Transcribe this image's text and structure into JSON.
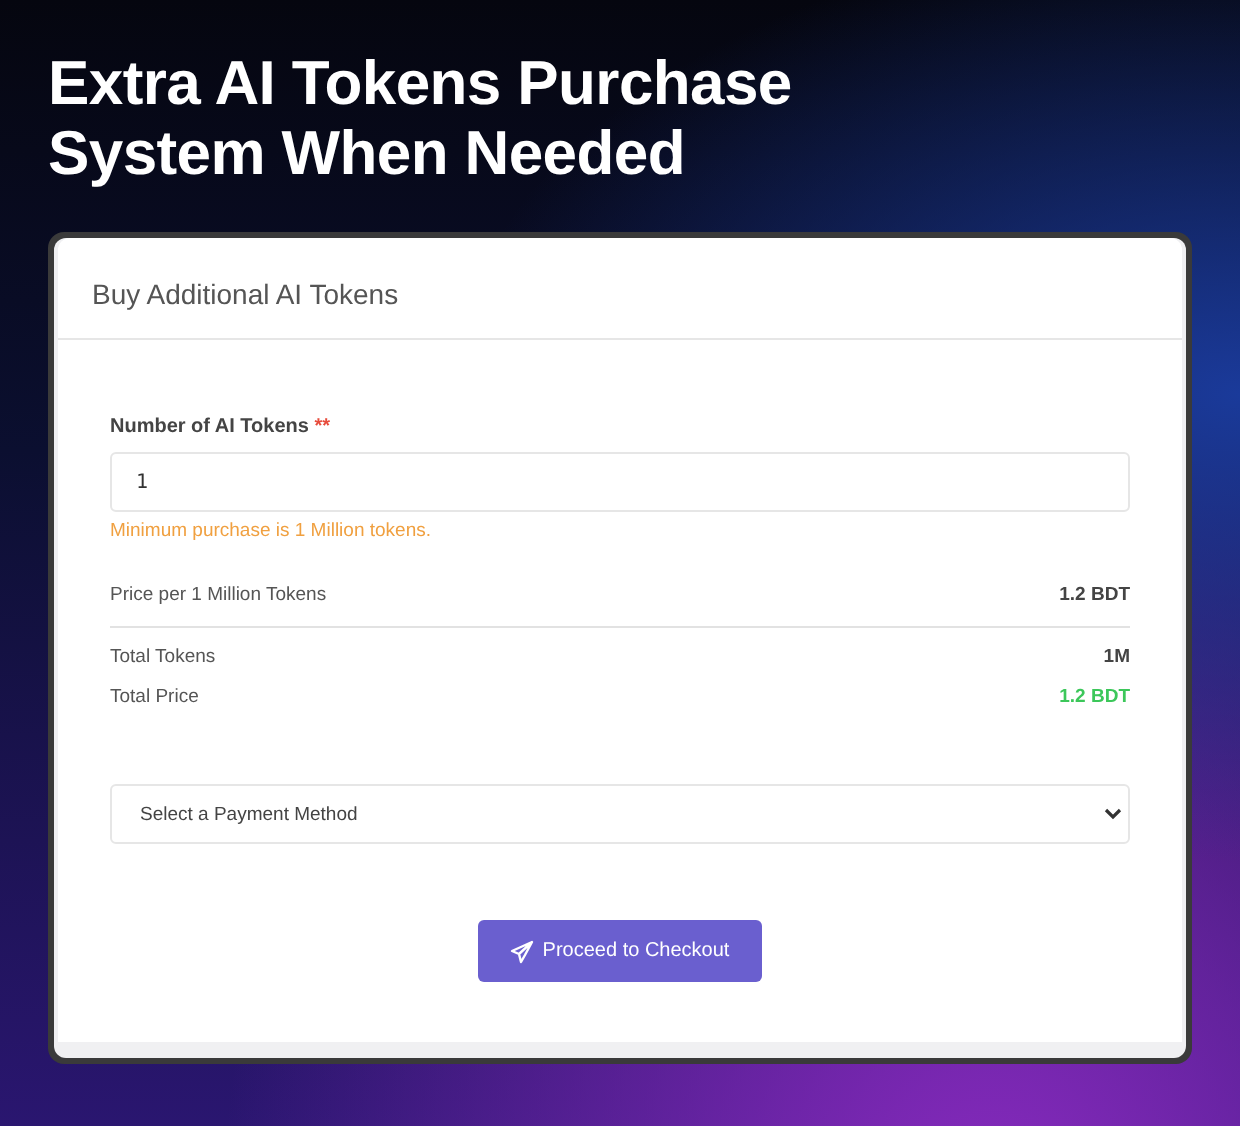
{
  "headline": "Extra AI Tokens Purchase System When Needed",
  "card": {
    "title": "Buy Additional AI Tokens",
    "token_field": {
      "label": "Number of AI Tokens",
      "required_mark": "**",
      "value": "1",
      "hint": "Minimum purchase is 1 Million tokens."
    },
    "summary": [
      {
        "label": "Price per 1 Million Tokens",
        "value": "1.2 BDT",
        "kind": "plain",
        "divider_below": true
      },
      {
        "label": "Total Tokens",
        "value": "1M",
        "kind": "plain",
        "divider_below": false
      },
      {
        "label": "Total Price",
        "value": "1.2 BDT",
        "kind": "total",
        "divider_below": false
      }
    ],
    "payment_select": {
      "placeholder": "Select a Payment Method"
    },
    "checkout_button": {
      "label": "Proceed to Checkout"
    }
  }
}
